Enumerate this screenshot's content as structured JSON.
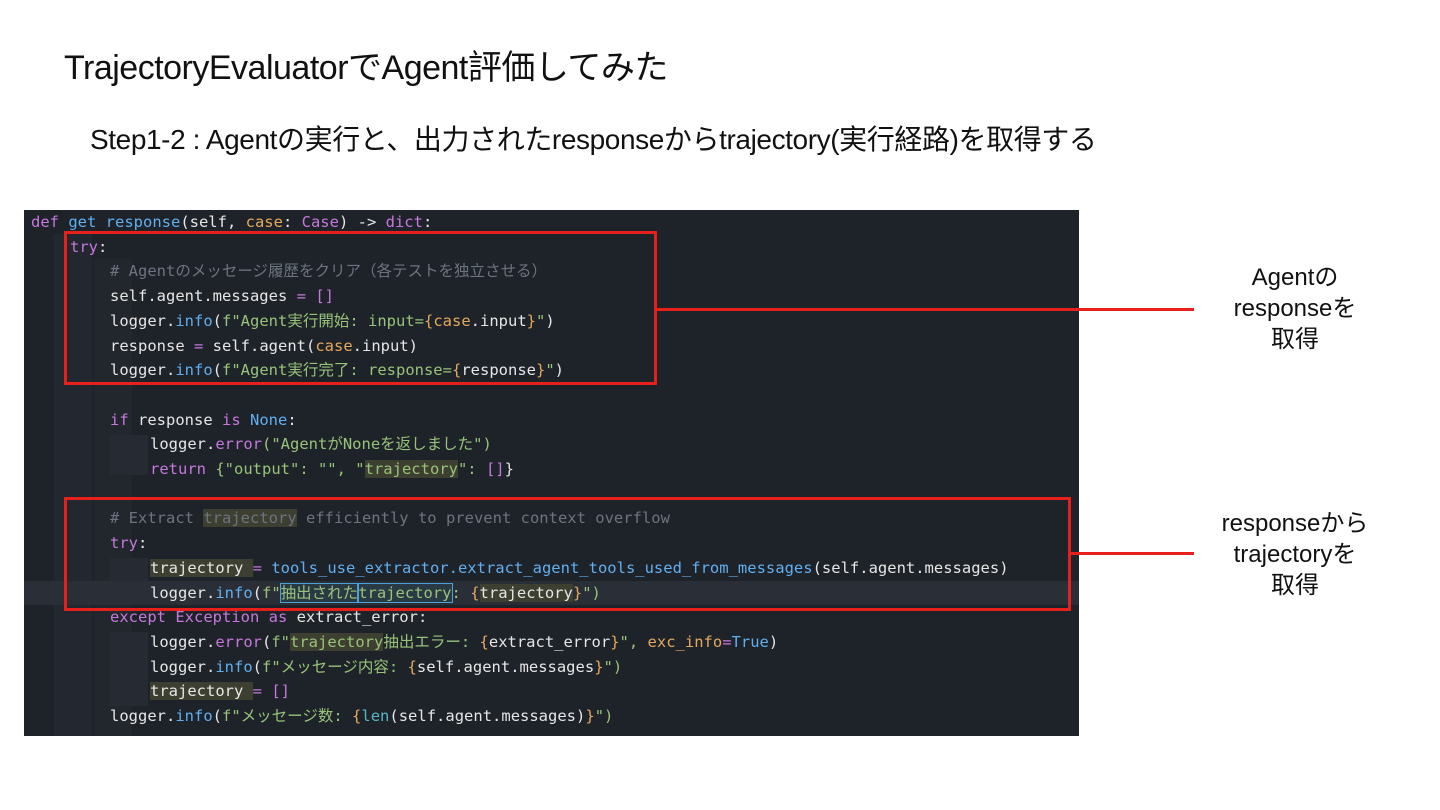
{
  "title": "TrajectoryEvaluatorでAgent評価してみた",
  "subtitle": "Step1-2 : Agentの実行と、出力されたresponseからtrajectory(実行経路)を取得する",
  "code": {
    "l1": {
      "a": "def ",
      "b": "get response",
      "c": "(self, ",
      "d": "case",
      "e": ": ",
      "f": "Case",
      "g": ") -> ",
      "h": "dict",
      "i": ":"
    },
    "l2": {
      "a": "try",
      "b": ":"
    },
    "l3": {
      "a": "# Agentのメッセージ履歴をクリア（各テストを独立させる）"
    },
    "l4": {
      "a": "self.agent.messages ",
      "b": "= ",
      "c": "[]"
    },
    "l5": {
      "a": "logger.",
      "b": "info",
      "c": "(",
      "d": "f\"Agent実行開始: input=",
      "e": "{",
      "f": "case",
      "g": ".input",
      "h": "}",
      "i": "\"",
      "j": ")"
    },
    "l6": {
      "a": "response ",
      "b": "= ",
      "c": "self.agent(",
      "d": "case",
      "e": ".input)"
    },
    "l7": {
      "a": "logger.",
      "b": "info",
      "c": "(",
      "d": "f\"Agent実行完了: response=",
      "e": "{",
      "f": "response",
      "g": "}",
      "h": "\"",
      "i": ")"
    },
    "l8": {
      "a": "if ",
      "b": "response ",
      "c": "is ",
      "d": "None",
      "e": ":"
    },
    "l9": {
      "a": "logger.",
      "b": "error",
      "c": "(\"AgentがNoneを返しました\")"
    },
    "l10": {
      "a": "return ",
      "b": "{\"output\": \"\", \"",
      "c": "trajectory",
      "d": "\": ",
      "e": "[]",
      "f": "}"
    },
    "l11": {
      "a": "# Extract ",
      "b": "trajectory",
      "c": " efficiently to prevent context overflow"
    },
    "l12": {
      "a": "try",
      "b": ":"
    },
    "l13": {
      "a": "trajectory ",
      "b": "= ",
      "c": "tools_use_extractor.",
      "d": "extract_agent_tools_used_from_messages",
      "e": "(self.agent.messages)"
    },
    "l14": {
      "a": "logger.",
      "b": "info",
      "c": "(",
      "d": "f\"",
      "e": "抽出された",
      "f": "trajectory",
      "g": ": ",
      "h": "{",
      "i": "trajectory",
      "j": "}",
      "k": "\")"
    },
    "l15": {
      "a": "except ",
      "b": "Exception ",
      "c": "as ",
      "d": "extract_error:"
    },
    "l16": {
      "a": "logger.",
      "b": "error",
      "c": "(",
      "d": "f\"",
      "e": "trajectory",
      "f": "抽出エラー: ",
      "g": "{",
      "h": "extract_error",
      "i": "}",
      "j": "\", ",
      "k": "exc_info",
      "l": "=",
      "m": "True",
      "n": ")"
    },
    "l17": {
      "a": "logger.",
      "b": "info",
      "c": "(",
      "d": "f\"メッセージ内容: ",
      "e": "{",
      "f": "self.agent.messages",
      "g": "}",
      "h": "\")"
    },
    "l18": {
      "a": "trajectory ",
      "b": "= ",
      "c": "[]"
    },
    "l19": {
      "a": "logger.",
      "b": "info",
      "c": "(",
      "d": "f\"メッセージ数: ",
      "e": "{",
      "f": "len",
      "g": "(self.agent.messages)",
      "h": "}",
      "i": "\")"
    }
  },
  "notes": {
    "top": [
      "Agentの",
      "responseを",
      "取得"
    ],
    "bottom": [
      "responseから",
      "trajectoryを",
      "取得"
    ]
  },
  "colors": {
    "callout": "#e8201c",
    "editor_bg": "#1e2229"
  }
}
